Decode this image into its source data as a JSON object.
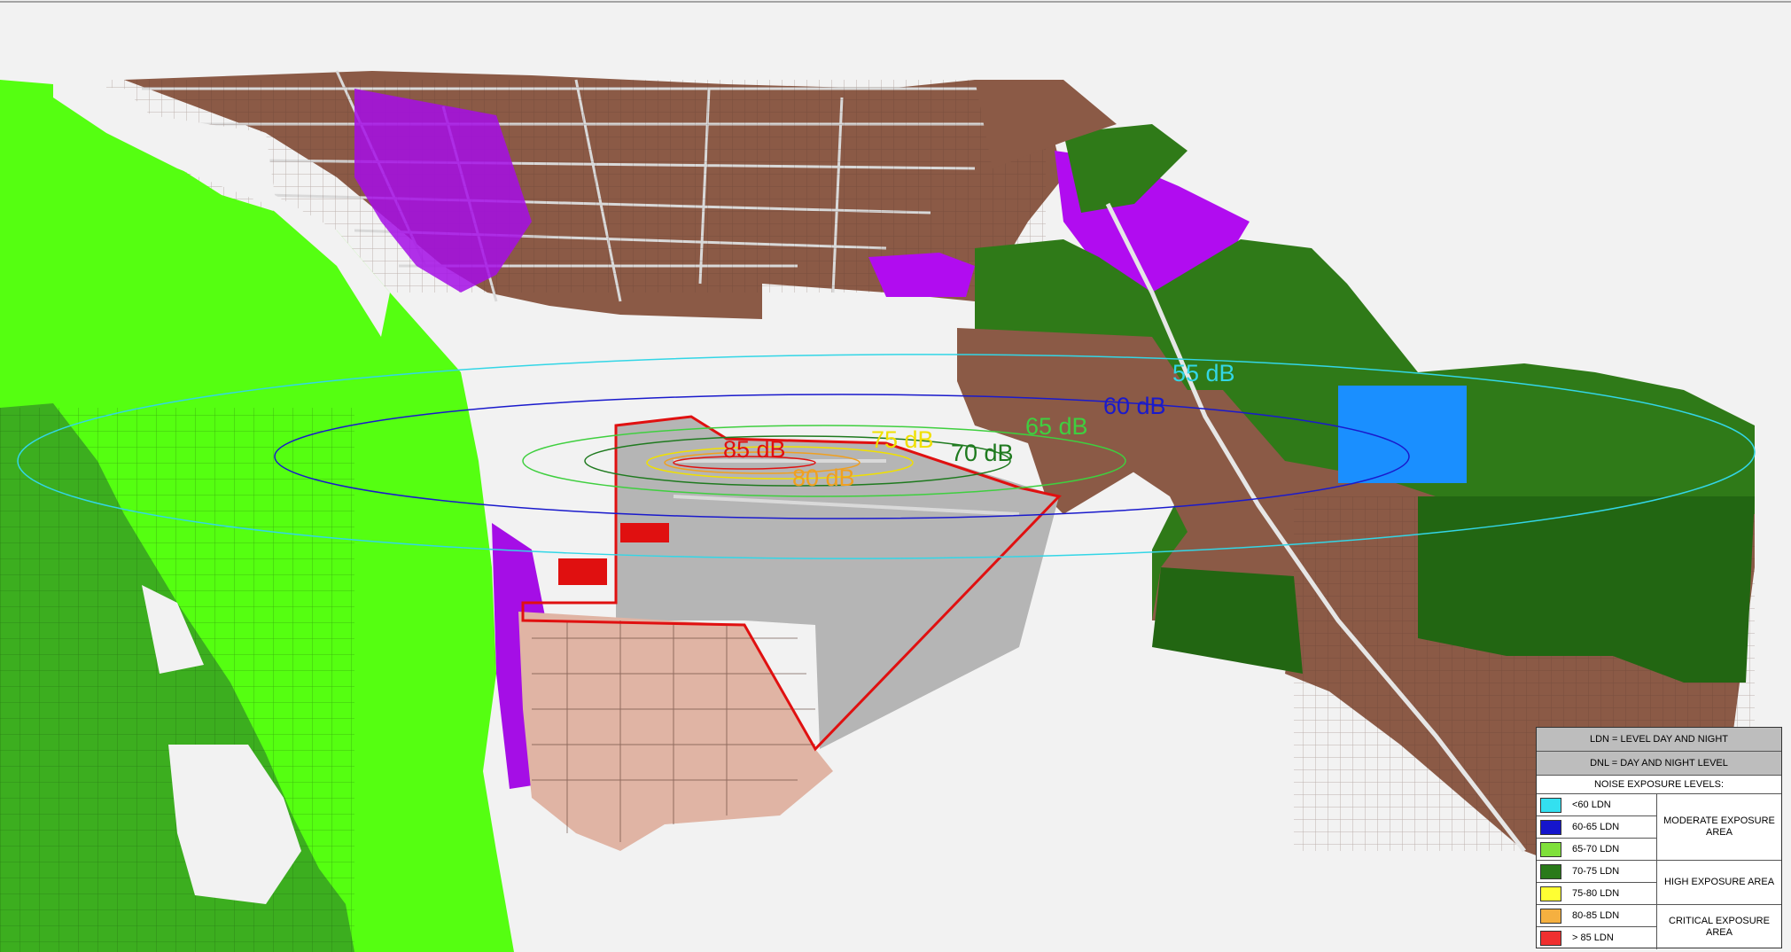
{
  "map": {
    "contour_labels": [
      {
        "text": "55 dB",
        "color": "#33d6e6"
      },
      {
        "text": "60 dB",
        "color": "#1a1acc"
      },
      {
        "text": "65 dB",
        "color": "#3fcf3f"
      },
      {
        "text": "70 dB",
        "color": "#1f7a1f"
      },
      {
        "text": "75 dB",
        "color": "#f0e000"
      },
      {
        "text": "80 dB",
        "color": "#f0a020"
      },
      {
        "text": "85 dB",
        "color": "#e01010"
      }
    ],
    "colors": {
      "vegetation_light": "#55ff11",
      "vegetation_dark": "#1f6e0f",
      "forest": "#2f7a18",
      "residential": "#8b5a46",
      "commercial": "#a50ee6",
      "airport": "#b5b5b5",
      "planned": "#e0b4a4",
      "water": "#1a8fff",
      "boundary": "#e01010"
    }
  },
  "legend": {
    "ldn_definition": "LDN = LEVEL DAY AND NIGHT",
    "dnl_definition": "DNL = DAY AND NIGHT LEVEL",
    "title": "NOISE EXPOSURE LEVELS:",
    "levels": [
      {
        "label": "<60   LDN",
        "color": "#33e0f0"
      },
      {
        "label": "60-65   LDN",
        "color": "#1515cc"
      },
      {
        "label": "65-70 LDN",
        "color": "#7fe03a"
      },
      {
        "label": "70-75 LDN",
        "color": "#2a7a1a"
      },
      {
        "label": "75-80 LDN",
        "color": "#ffff33"
      },
      {
        "label": "80-85 LDN",
        "color": "#f5b040"
      },
      {
        "label": "> 85 LDN",
        "color": "#f03030"
      }
    ],
    "categories": [
      "MODERATE EXPOSURE AREA",
      "HIGH EXPOSURE AREA",
      "CRITICAL EXPOSURE AREA"
    ]
  }
}
